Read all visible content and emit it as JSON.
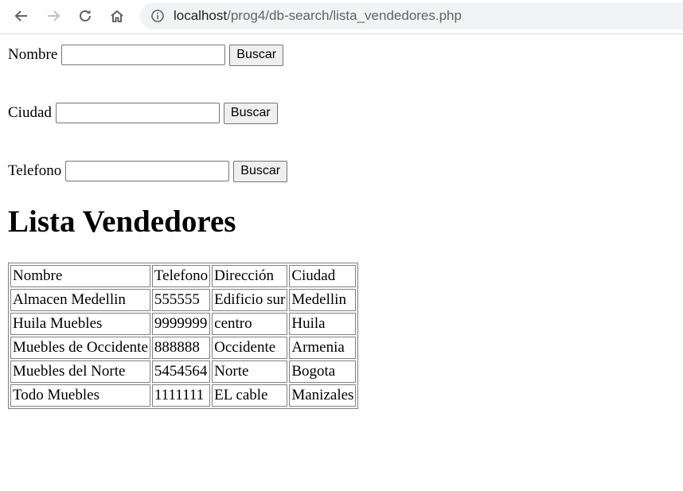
{
  "browser": {
    "url_host": "localhost",
    "url_path": "/prog4/db-search/lista_vendedores.php"
  },
  "search": [
    {
      "label": "Nombre",
      "value": "",
      "button": "Buscar"
    },
    {
      "label": "Ciudad",
      "value": "",
      "button": "Buscar"
    },
    {
      "label": "Telefono",
      "value": "",
      "button": "Buscar"
    }
  ],
  "heading": "Lista Vendedores",
  "table": {
    "headers": [
      "Nombre",
      "Telefono",
      "Dirección",
      "Ciudad"
    ],
    "rows": [
      [
        "Almacen Medellin",
        "555555",
        "Edificio sur",
        "Medellin"
      ],
      [
        "Huila Muebles",
        "9999999",
        "centro",
        "Huila"
      ],
      [
        "Muebles de Occidente",
        "888888",
        "Occidente",
        "Armenia"
      ],
      [
        "Muebles del Norte",
        "5454564",
        "Norte",
        "Bogota"
      ],
      [
        "Todo Muebles",
        "1111111",
        "EL cable",
        "Manizales"
      ]
    ]
  }
}
